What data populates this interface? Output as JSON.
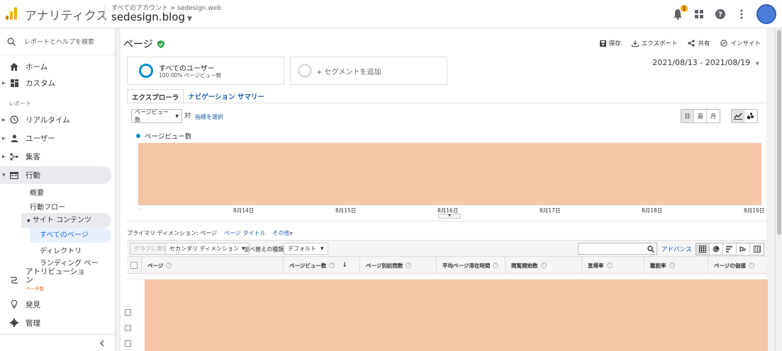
{
  "topbar": {
    "app_name": "アナリティクス",
    "account_path": "すべてのアカウント > sedesign.web",
    "account_name": "sedesign.blog",
    "notification_count": "1",
    "brand_colors": [
      "#f9ab00",
      "#e37400"
    ]
  },
  "sidebar": {
    "search_label": "レポートとヘルプを検索",
    "home": "ホーム",
    "custom": "カスタム",
    "reports_section": "レポート",
    "realtime": "リアルタイム",
    "audience": "ユーザー",
    "acquisition": "集客",
    "behavior": "行動",
    "behavior_overview": "概要",
    "behavior_flow": "行動フロー",
    "site_content": "サイト コンテンツ",
    "all_pages": "すべてのページ",
    "directory": "ディレクトリ",
    "landing_pages": "ランディング ペー",
    "attribution_line1": "アトリビューショ",
    "attribution_line2": "ン",
    "attribution_badge": "ベータ版",
    "discover": "発見",
    "admin": "管理"
  },
  "report": {
    "title": "ページ",
    "actions": {
      "save": "保存",
      "export": "エクスポート",
      "share": "共有",
      "insights": "インサイト"
    },
    "segment_all_users": "すべてのユーザー",
    "segment_all_users_sub": "100.00% ページビュー数",
    "add_segment": "+ セグメントを追加",
    "date_range": "2021/08/13 - 2021/08/19",
    "tabs": [
      "エクスプローラ",
      "ナビゲーション サマリー"
    ],
    "metric_dropdown": "ページビュー数",
    "vs_label": "対",
    "select_metric": "指標を選択",
    "period_buttons": [
      "日",
      "週",
      "月"
    ],
    "legend_label": "ページビュー数",
    "x_ticks": [
      "8月14日",
      "8月15日",
      "8月16日",
      "8月17日",
      "8月18日",
      "8月19日"
    ],
    "x_ellipsis": "...",
    "primary_dimension_label": "プライマリ ディメンション:",
    "primary_dimension_value": "ページ",
    "page_title_link": "ページ タイトル",
    "other_link": "その他",
    "toolbar": {
      "plot_rows": "グラフに表示",
      "secondary_dimension": "セカンダリ ディメンション",
      "sort_type_label": "並べ替えの種類:",
      "sort_default": "デフォルト",
      "advanced": "アドバンス"
    },
    "table_headers": [
      "ページ",
      "ページビュー数",
      "ページ別訪問数",
      "平均ページ滞在時間",
      "閲覧開始数",
      "直帰率",
      "離脱率",
      "ページの価値"
    ]
  }
}
